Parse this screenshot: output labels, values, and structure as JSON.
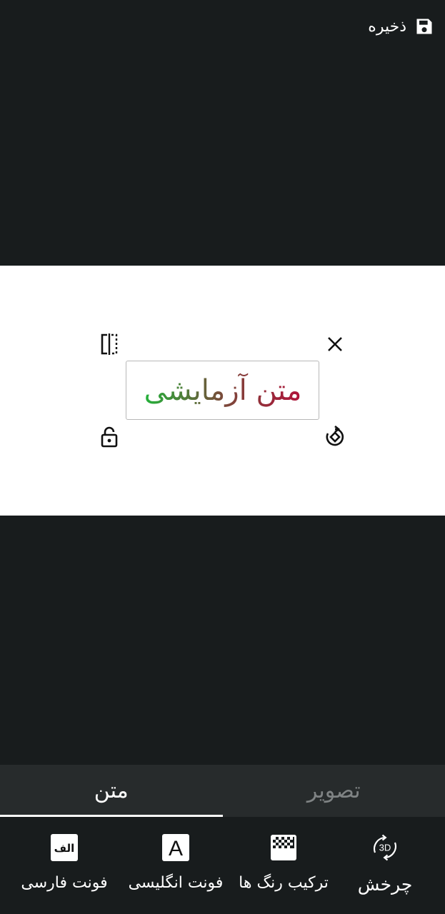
{
  "header": {
    "save_label": "ذخیره",
    "save_icon": "floppy-disk-icon"
  },
  "canvas": {
    "background": "#ffffff",
    "sticker_text": "متن آزمایشی",
    "gradient_colors": [
      "#b0123a",
      "#7a4a3a",
      "#23b23a"
    ],
    "handles": [
      "flip-icon",
      "close-icon",
      "lock-icon",
      "rotate-icon"
    ]
  },
  "tabs": {
    "text_label": "متن",
    "image_label": "تصویر",
    "active": "text"
  },
  "toolbar": {
    "persian_font_label": "فونت فارسی",
    "persian_font_glyph": "الف",
    "english_font_label": "فونت انگلیسی",
    "english_font_glyph": "A",
    "color_combo_label": "ترکیب رنگ ها",
    "rotation_label": "چرخش",
    "rotation_glyph": "3D"
  }
}
